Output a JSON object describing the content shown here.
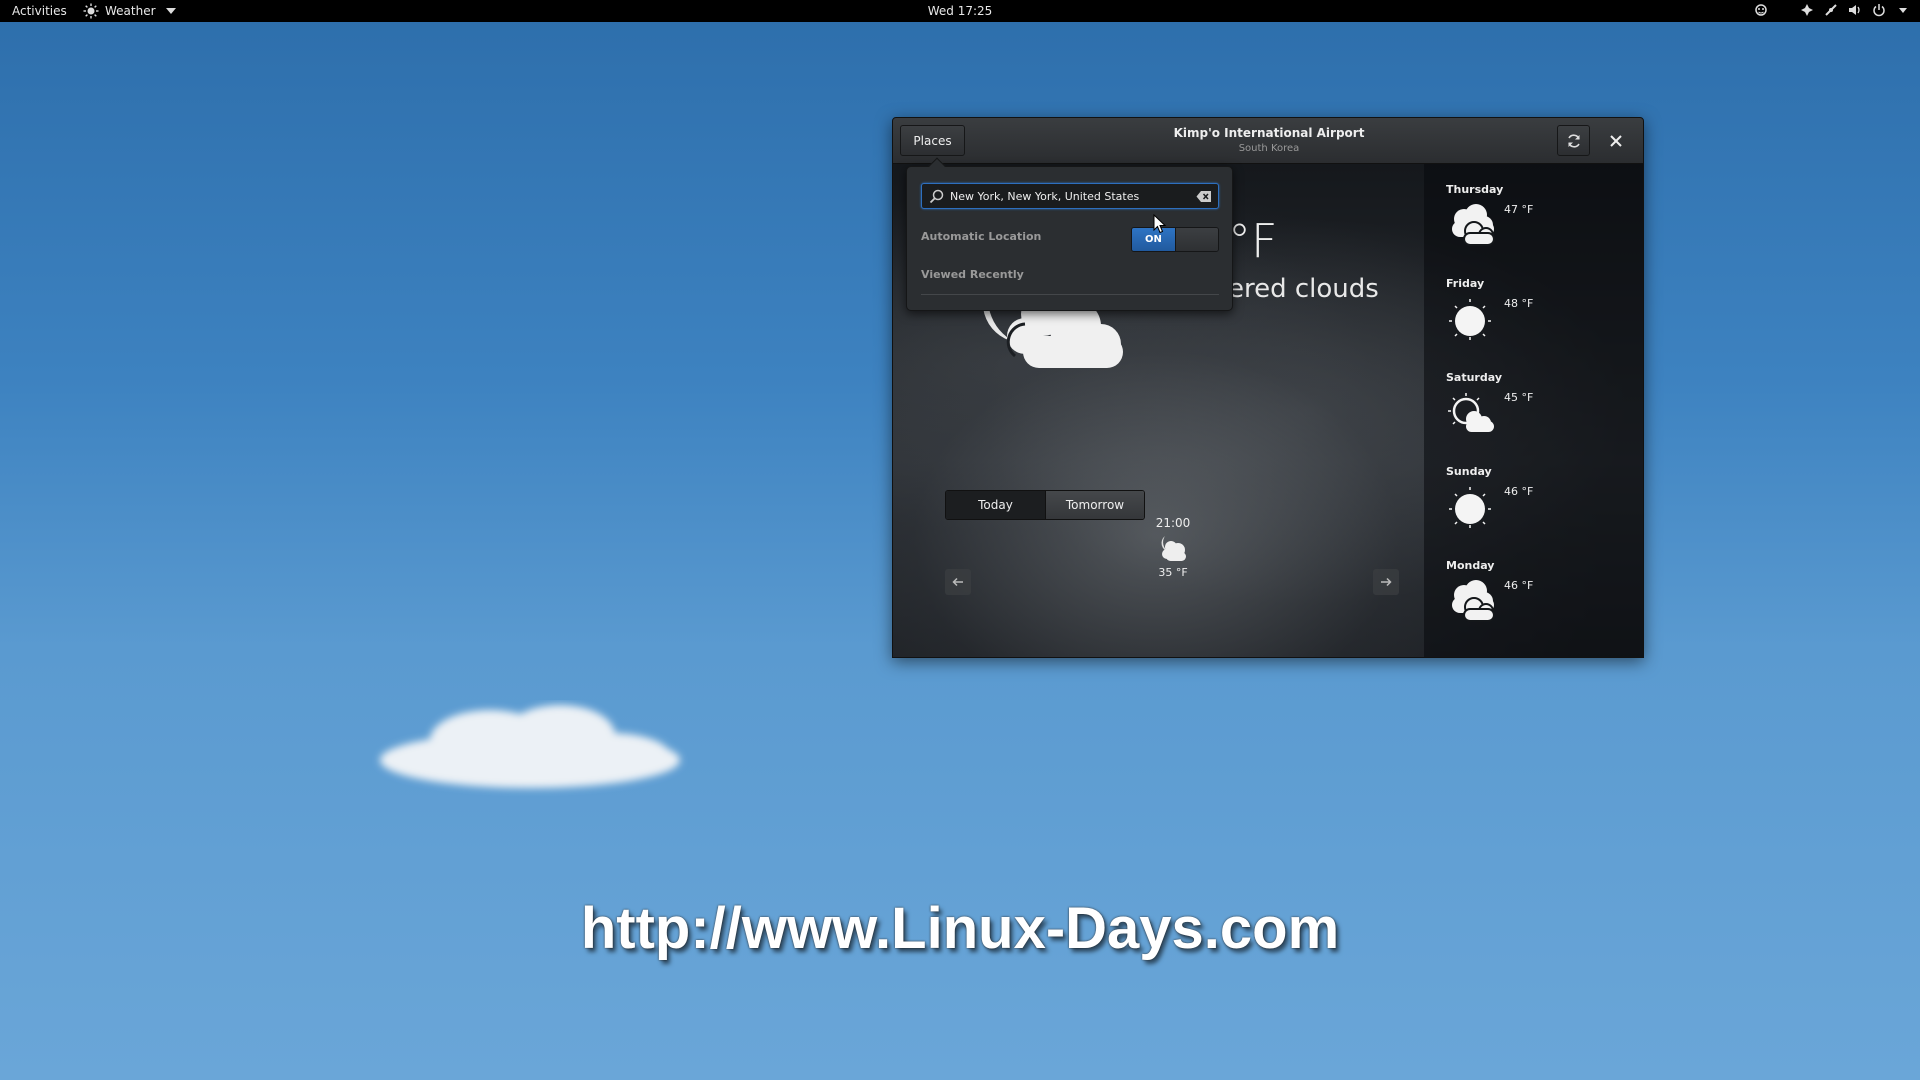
{
  "topbar": {
    "activities": "Activities",
    "app_name": "Weather",
    "clock": "Wed 17:25",
    "tray_icons": [
      "weather-icon",
      "accessibility-icon",
      "network-icon",
      "volume-icon",
      "power-icon",
      "chevron-down-icon"
    ]
  },
  "window": {
    "places_button": "Places",
    "title": "Kimp'o International Airport",
    "subtitle": "South Korea",
    "current": {
      "temperature_fragment": "°F",
      "condition_fragment": "ered clouds",
      "icon": "night-cloudy-icon"
    },
    "tabs": {
      "today": "Today",
      "tomorrow": "Tomorrow"
    },
    "hourly": {
      "time": "21:00",
      "temp": "35 °F",
      "icon": "night-cloudy-icon"
    },
    "forecast": [
      {
        "day": "Thursday",
        "temp": "47 °F",
        "icon": "cloudy-icon"
      },
      {
        "day": "Friday",
        "temp": "48 °F",
        "icon": "sunny-icon"
      },
      {
        "day": "Saturday",
        "temp": "45 °F",
        "icon": "partly-cloudy-icon"
      },
      {
        "day": "Sunday",
        "temp": "46 °F",
        "icon": "sunny-icon"
      },
      {
        "day": "Monday",
        "temp": "46 °F",
        "icon": "cloudy-icon"
      }
    ]
  },
  "popover": {
    "search_value": "New York, New York, United States",
    "automatic_location_label": "Automatic Location",
    "automatic_location_state": "ON",
    "viewed_recently_label": "Viewed Recently"
  },
  "desktop": {
    "watermark": "http://www.Linux-Days.com"
  },
  "colors": {
    "accent": "#2e74c4",
    "topbar": "#000000",
    "desktop": "#3d82c0"
  }
}
